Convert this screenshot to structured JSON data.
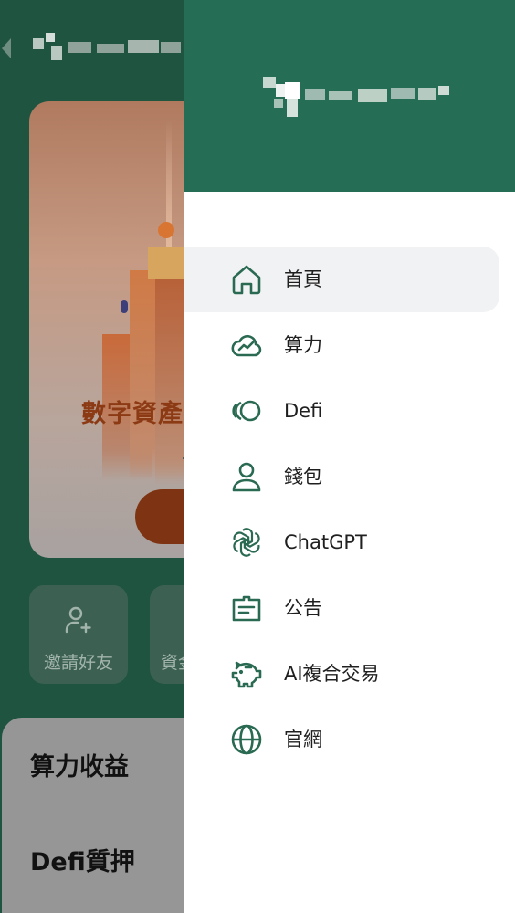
{
  "background": {
    "banner_title": "數字資產",
    "quick_actions": [
      {
        "label": "邀請好友",
        "icon": "add-user-icon"
      },
      {
        "label": "資金",
        "icon": "wallet-icon"
      }
    ],
    "sections": [
      "算力收益",
      "Defi質押"
    ]
  },
  "drawer": {
    "menu": [
      {
        "label": "首頁",
        "icon": "home-icon",
        "active": true
      },
      {
        "label": "算力",
        "icon": "cloud-chart-icon",
        "active": false
      },
      {
        "label": "Defi",
        "icon": "defi-rings-icon",
        "active": false
      },
      {
        "label": "錢包",
        "icon": "user-icon",
        "active": false
      },
      {
        "label": "ChatGPT",
        "icon": "openai-icon",
        "active": false
      },
      {
        "label": "公告",
        "icon": "announcement-icon",
        "active": false
      },
      {
        "label": "AI複合交易",
        "icon": "piggy-bank-icon",
        "active": false
      },
      {
        "label": "官網",
        "icon": "globe-icon",
        "active": false
      }
    ]
  },
  "colors": {
    "brand_green": "#256d54",
    "icon_green": "#2a6a52",
    "active_bg": "#f1f2f3"
  }
}
